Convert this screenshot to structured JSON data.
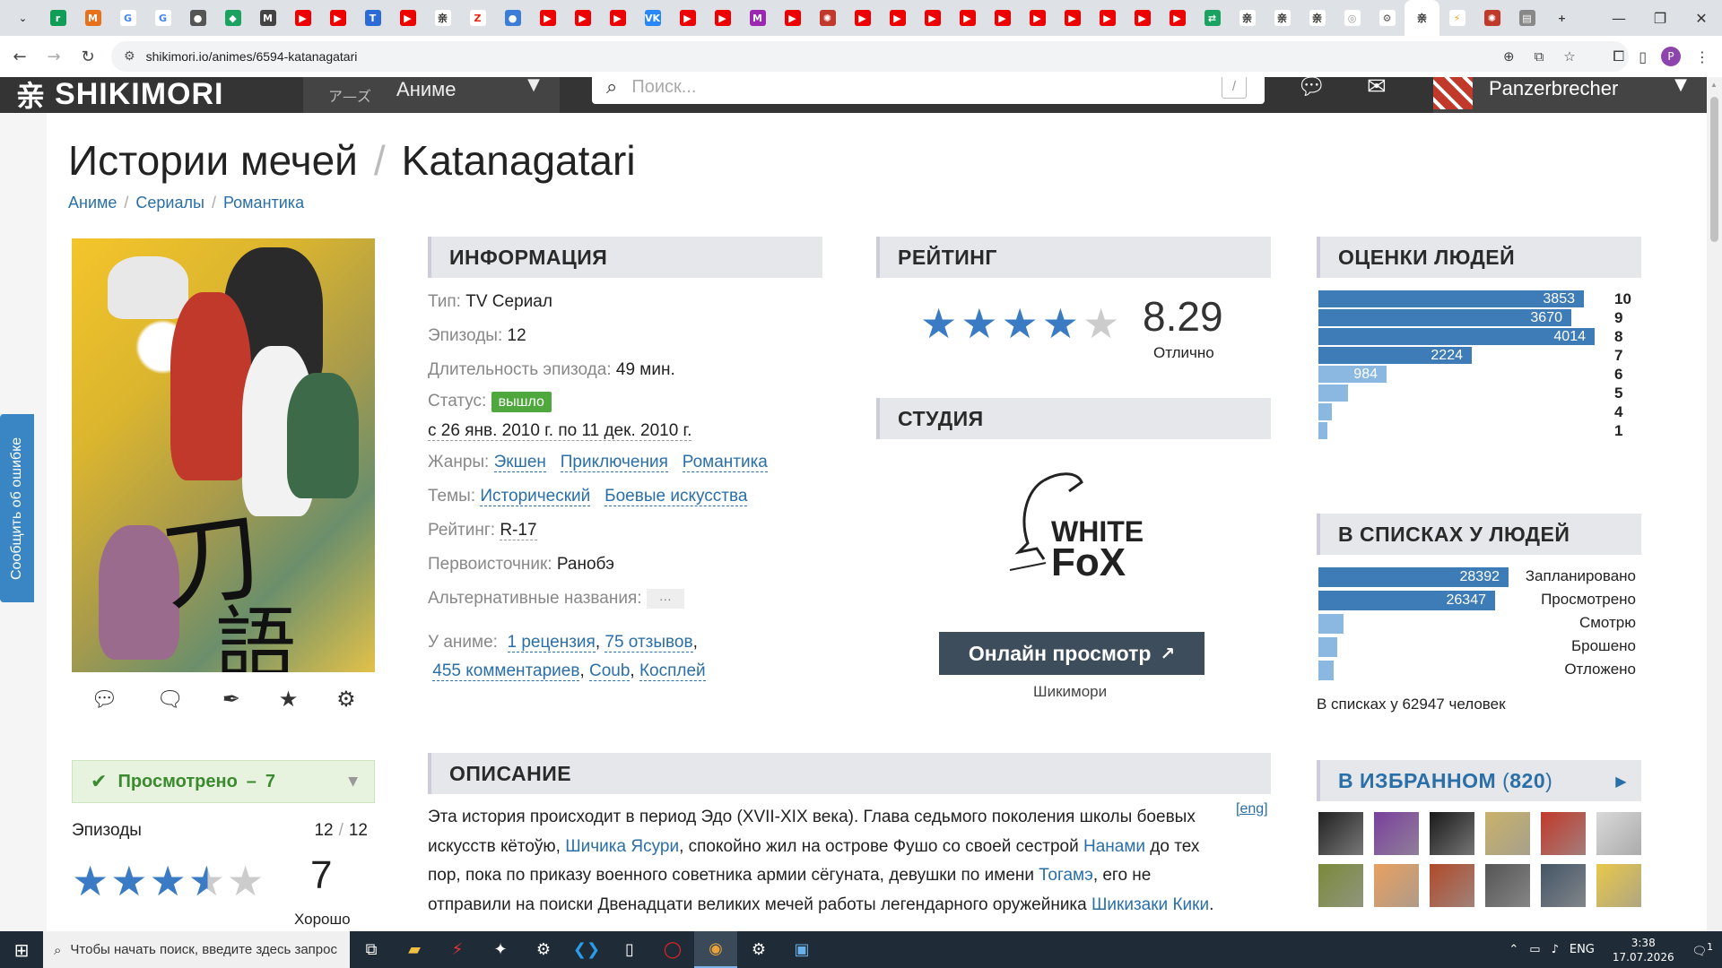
{
  "browser": {
    "tabs": [
      {
        "name": "tab-dropdown",
        "glyph": "⌄",
        "color": "#dee1e6",
        "fg": "#333"
      },
      {
        "name": "tab-1",
        "glyph": "r",
        "color": "#0f9d58"
      },
      {
        "name": "tab-2",
        "glyph": "M",
        "color": "#e8711c"
      },
      {
        "name": "tab-3",
        "glyph": "G",
        "color": "#ffffff",
        "fg": "#4285f4"
      },
      {
        "name": "tab-4",
        "glyph": "G",
        "color": "#ffffff",
        "fg": "#4285f4"
      },
      {
        "name": "tab-5",
        "glyph": "●",
        "color": "#555"
      },
      {
        "name": "tab-6",
        "glyph": "◆",
        "color": "#1aa260"
      },
      {
        "name": "tab-7",
        "glyph": "M",
        "color": "#444"
      },
      {
        "name": "tab-8",
        "glyph": "▶",
        "color": "#e00"
      },
      {
        "name": "tab-9",
        "glyph": "▶",
        "color": "#e00"
      },
      {
        "name": "tab-10",
        "glyph": "T",
        "color": "#2c6bd6"
      },
      {
        "name": "tab-11",
        "glyph": "▶",
        "color": "#e00"
      },
      {
        "name": "tab-12",
        "glyph": "亲",
        "color": "#ffffff",
        "fg": "#333"
      },
      {
        "name": "tab-13",
        "glyph": "Z",
        "color": "#ffffff",
        "fg": "#e21"
      },
      {
        "name": "tab-14",
        "glyph": "●",
        "color": "#3b7dd8"
      },
      {
        "name": "tab-15",
        "glyph": "▶",
        "color": "#e00"
      },
      {
        "name": "tab-16",
        "glyph": "▶",
        "color": "#e00"
      },
      {
        "name": "tab-17",
        "glyph": "▶",
        "color": "#e00"
      },
      {
        "name": "tab-18",
        "glyph": "VK",
        "color": "#2787f5"
      },
      {
        "name": "tab-19",
        "glyph": "▶",
        "color": "#e00"
      },
      {
        "name": "tab-20",
        "glyph": "▶",
        "color": "#e00"
      },
      {
        "name": "tab-21",
        "glyph": "M",
        "color": "#9c27b0"
      },
      {
        "name": "tab-22",
        "glyph": "▶",
        "color": "#e00"
      },
      {
        "name": "tab-23",
        "glyph": "✺",
        "color": "#c0392b"
      },
      {
        "name": "tab-24",
        "glyph": "▶",
        "color": "#e00"
      },
      {
        "name": "tab-25",
        "glyph": "▶",
        "color": "#e00"
      },
      {
        "name": "tab-26",
        "glyph": "▶",
        "color": "#e00"
      },
      {
        "name": "tab-27",
        "glyph": "▶",
        "color": "#e00"
      },
      {
        "name": "tab-28",
        "glyph": "▶",
        "color": "#e00"
      },
      {
        "name": "tab-29",
        "glyph": "▶",
        "color": "#e00"
      },
      {
        "name": "tab-30",
        "glyph": "▶",
        "color": "#e00"
      },
      {
        "name": "tab-31",
        "glyph": "▶",
        "color": "#e00"
      },
      {
        "name": "tab-32",
        "glyph": "▶",
        "color": "#e00"
      },
      {
        "name": "tab-33",
        "glyph": "▶",
        "color": "#e00"
      },
      {
        "name": "tab-34",
        "glyph": "⇄",
        "color": "#1aa260"
      },
      {
        "name": "tab-35",
        "glyph": "亲",
        "color": "#ffffff",
        "fg": "#333"
      },
      {
        "name": "tab-36",
        "glyph": "亲",
        "color": "#ffffff",
        "fg": "#333"
      },
      {
        "name": "tab-37",
        "glyph": "亲",
        "color": "#ffffff",
        "fg": "#333"
      },
      {
        "name": "tab-38",
        "glyph": "◎",
        "color": "#ffffff",
        "fg": "#999"
      },
      {
        "name": "tab-39",
        "glyph": "⚙",
        "color": "#ffffff",
        "fg": "#555"
      },
      {
        "name": "tab-40-active",
        "glyph": "亲",
        "color": "#ffffff",
        "fg": "#333",
        "active": true
      },
      {
        "name": "tab-41",
        "glyph": "⚡",
        "color": "#ffffff",
        "fg": "#f5a623"
      },
      {
        "name": "tab-42",
        "glyph": "✺",
        "color": "#c0392b"
      },
      {
        "name": "tab-43",
        "glyph": "▤",
        "color": "#888"
      },
      {
        "name": "new-tab",
        "glyph": "+",
        "color": "#dee1e6",
        "fg": "#333"
      }
    ],
    "url": "shikimori.io/animes/6594-katanagatari"
  },
  "site": {
    "logo": "SHIKIMORI",
    "menu_jp": "ア—ズ",
    "menu_label": "Аниме",
    "search_placeholder": "Поиск...",
    "search_key": "/",
    "username": "Panzerbrecher"
  },
  "report_label": "Сообщить об ошибке",
  "title": {
    "ru": "Истории мечей",
    "sep": "/",
    "en": "Katanagatari"
  },
  "breadcrumbs": [
    "Аниме",
    "Сериалы",
    "Романтика"
  ],
  "user_rate": {
    "status": "Просмотрено",
    "dash": "–",
    "score": "7",
    "episodes_label": "Эпизоды",
    "episodes_watched": "12",
    "episodes_total": "12",
    "score_label": "Хорошо",
    "stars": 3.5
  },
  "info": {
    "header": "ИНФОРМАЦИЯ",
    "type_k": "Тип:",
    "type_v": "TV Сериал",
    "eps_k": "Эпизоды:",
    "eps_v": "12",
    "dur_k": "Длительность эпизода:",
    "dur_v": "49 мин.",
    "status_k": "Статус:",
    "status_v": "вышло",
    "dates": "с 26 янв. 2010 г. по 11 дек. 2010 г.",
    "genres_k": "Жанры:",
    "genres": [
      "Экшен",
      "Приключения",
      "Романтика"
    ],
    "themes_k": "Темы:",
    "themes": [
      "Исторический",
      "Боевые искусства"
    ],
    "rating_k": "Рейтинг:",
    "rating_v": "R-17",
    "source_k": "Первоисточник:",
    "source_v": "Ранобэ",
    "alt_k": "Альтернативные названия:",
    "alt_v": "···",
    "about_k": "У аниме:",
    "about_links": [
      "1 рецензия",
      "75 отзывов",
      "455 комментариев",
      "Coub",
      "Косплей"
    ]
  },
  "rating": {
    "header": "РЕЙТИНГ",
    "score": "8.29",
    "label": "Отлично",
    "stars": 4
  },
  "studio": {
    "header": "СТУДИЯ",
    "name": "WHITE FOX",
    "watch_btn": "Онлайн просмотр",
    "watch_sub": "Шикимори"
  },
  "scores": {
    "header": "ОЦЕНКИ ЛЮДЕЙ",
    "rows": [
      {
        "score": "10",
        "count": 3853,
        "label": "3853"
      },
      {
        "score": "9",
        "count": 3670,
        "label": "3670"
      },
      {
        "score": "8",
        "count": 4014,
        "label": "4014"
      },
      {
        "score": "7",
        "count": 2224,
        "label": "2224"
      },
      {
        "score": "6",
        "count": 984,
        "label": "984"
      },
      {
        "score": "5",
        "count": 430,
        "label": ""
      },
      {
        "score": "4",
        "count": 200,
        "label": ""
      },
      {
        "score": "1",
        "count": 100,
        "label": ""
      }
    ]
  },
  "lists": {
    "header": "В СПИСКАХ У ЛЮДЕЙ",
    "rows": [
      {
        "name": "Запланировано",
        "count": 28392,
        "label": "28392"
      },
      {
        "name": "Просмотрено",
        "count": 26347,
        "label": "26347"
      },
      {
        "name": "Смотрю",
        "count": 3800,
        "label": ""
      },
      {
        "name": "Брошено",
        "count": 2800,
        "label": ""
      },
      {
        "name": "Отложено",
        "count": 2300,
        "label": ""
      }
    ],
    "total": "В списках у 62947 человек"
  },
  "favs": {
    "header": "В ИЗБРАННОМ",
    "count": "820",
    "paren_open": "(",
    "paren_close": ")",
    "arrow": "▶",
    "thumbs": [
      "#222",
      "#7a3f9c",
      "#1a1a1a",
      "#c9b26a",
      "#c0392b",
      "#d9d9d9",
      "#7a8a3a",
      "#e8a060",
      "#b04a2a",
      "#555",
      "#445566",
      "#e8c84a"
    ]
  },
  "description": {
    "header": "ОПИСАНИЕ",
    "eng": "[eng]",
    "t1": "Эта история происходит в период Эдо (XVII-XIX века). Глава седьмого поколения школы боевых искусств кётоўю, ",
    "l1": "Шичика Ясури",
    "t2": ", спокойно жил на острове Фушо со своей сестрой ",
    "l2": "Нанами",
    "t3": " до тех пор, пока по приказу военного советника армии сёгуната, девушки по имени ",
    "l3": "Тогамэ",
    "t4": ", его не отправили на поиски Двенадцати великих мечей работы легендарного оружейника ",
    "l4": "Шикизаки Кики",
    "t5": "."
  },
  "taskbar": {
    "search_placeholder": "Чтобы начать поиск, введите здесь запрос",
    "lang": "ENG",
    "time": "3:38",
    "date": "17.07.2026",
    "notif": "1"
  }
}
